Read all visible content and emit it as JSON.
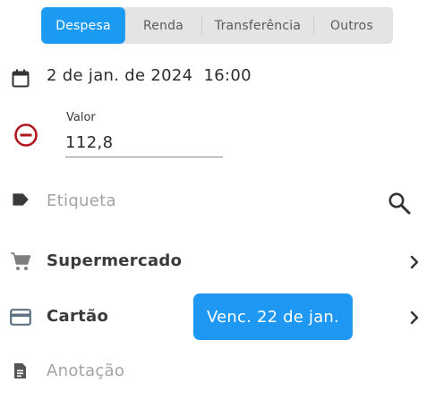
{
  "tabs": [
    {
      "label": "Despesa",
      "active": true
    },
    {
      "label": "Renda",
      "active": false
    },
    {
      "label": "Transferência",
      "active": false
    },
    {
      "label": "Outros",
      "active": false
    }
  ],
  "date": {
    "text": "2 de jan. de 2024  16:00",
    "icon": "calendar-icon"
  },
  "amount": {
    "label": "Valor",
    "value": "112,8",
    "icon": "minus-circle-icon",
    "icon_color": "#b0171f"
  },
  "tag": {
    "placeholder": "Etiqueta",
    "icon": "tag-icon",
    "action_icon": "search-icon"
  },
  "category": {
    "label": "Supermercado",
    "icon": "cart-icon",
    "action_icon": "chevron-right-icon"
  },
  "account": {
    "label": "Cartão",
    "badge": "Venc. 22 de jan.",
    "icon": "credit-card-icon",
    "action_icon": "chevron-right-icon"
  },
  "note": {
    "placeholder": "Anotação",
    "icon": "document-icon"
  },
  "colors": {
    "accent": "#1a9af0",
    "badge": "#1e98f3",
    "negative": "#b0171f"
  }
}
